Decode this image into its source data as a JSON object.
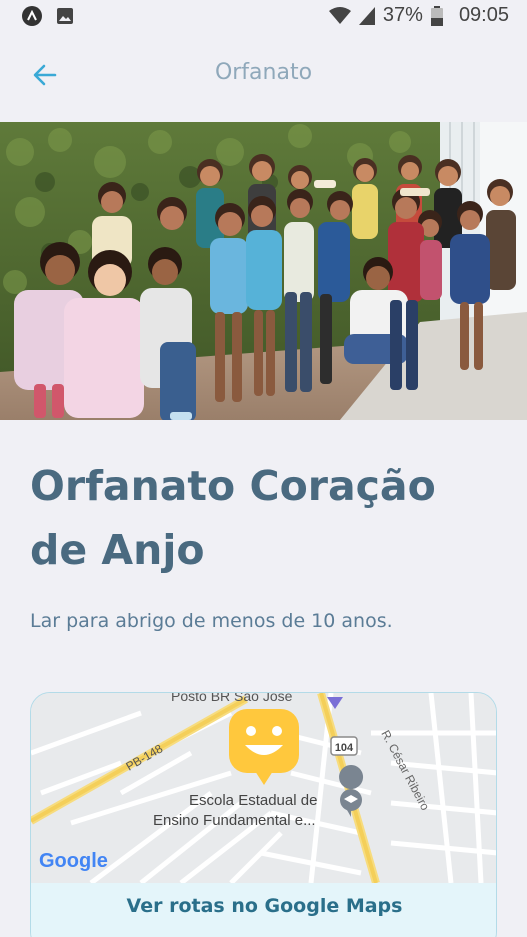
{
  "status_bar": {
    "battery_percent": "37%",
    "time": "09:05"
  },
  "app_bar": {
    "title": "Orfanato",
    "back_icon": "arrow-left-icon"
  },
  "place": {
    "name": "Orfanato Coração de Anjo",
    "description": "Lar para abrigo de menos de 10 anos."
  },
  "map": {
    "labels": {
      "poi_top": "Posto BR São José",
      "road_pb": "PB-148",
      "road_104": "104",
      "street": "R. César Ribeiro",
      "school_line1": "Escola Estadual de",
      "school_line2": "Ensino Fundamental e...",
      "provider": "Google"
    },
    "link_label": "Ver rotas no Google Maps",
    "marker_icon": "smiley-marker-icon"
  },
  "colors": {
    "accent": "#3aa9d6",
    "title": "#4a6a80",
    "marker": "#ffc83d"
  }
}
